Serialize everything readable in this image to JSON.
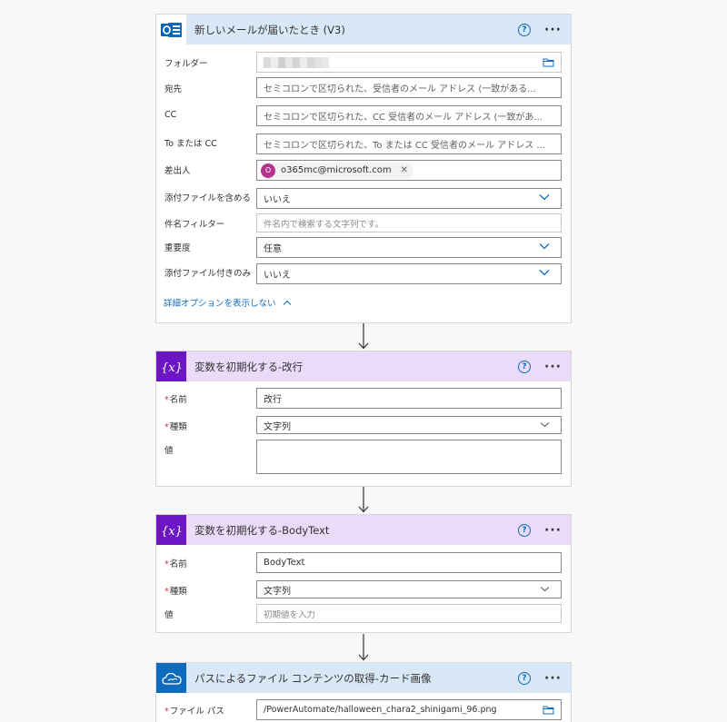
{
  "card1": {
    "title": "新しいメールが届いたとき (V3)",
    "help": "?",
    "more": "···",
    "fields": {
      "folder_label": "フォルダー",
      "to_label": "宛先",
      "to_placeholder": "セミコロンで区切られた、受信者のメール アドレス (一致がある...",
      "cc_label": "CC",
      "cc_placeholder": "セミコロンで区切られた、CC 受信者のメール アドレス (一致があ...",
      "toorcc_label": "To または CC",
      "toorcc_placeholder": "セミコロンで区切られた、To または CC 受信者のメール アドレス ...",
      "from_label": "差出人",
      "from_avatar": "O",
      "from_value": "o365mc@microsoft.com",
      "from_remove": "✕",
      "attach_label": "添付ファイルを含める",
      "attach_value": "いいえ",
      "subject_label": "件名フィルター",
      "subject_placeholder": "件名内で検索する文字列です。",
      "importance_label": "重要度",
      "importance_value": "任意",
      "attachonly_label": "添付ファイル付きのみ",
      "attachonly_value": "いいえ"
    },
    "advanced_link": "詳細オプションを表示しない"
  },
  "card2": {
    "title": "変数を初期化する-改行",
    "help": "?",
    "more": "···",
    "name_label": "名前",
    "name_value": "改行",
    "type_label": "種類",
    "type_value": "文字列",
    "value_label": "値"
  },
  "card3": {
    "title": "変数を初期化する-BodyText",
    "help": "?",
    "more": "···",
    "name_label": "名前",
    "name_value": "BodyText",
    "type_label": "種類",
    "type_value": "文字列",
    "value_label": "値",
    "value_placeholder": "初期値を入力"
  },
  "card4": {
    "title": "パスによるファイル コンテンツの取得-カード画像",
    "help": "?",
    "more": "···",
    "path_label": "ファイル パス",
    "path_value": "/PowerAutomate/halloween_chara2_shinigami_96.png"
  },
  "required_mark": "*",
  "colors": {
    "outlook_blue": "#0f6cbd",
    "variable_purple": "#6b15c4",
    "header_blue": "#d9e8f6",
    "header_purple": "#eadcf9"
  }
}
